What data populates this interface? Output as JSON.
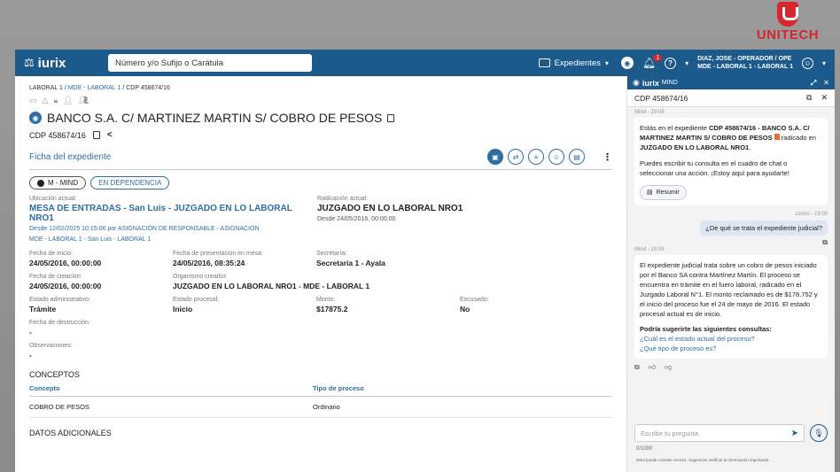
{
  "logo": {
    "text": "UNITECH"
  },
  "topbar": {
    "brand": "iurix",
    "search_placeholder": "Número y/o Sufijo o Carátula",
    "expedientes_label": "Expedientes",
    "notif_count": "1",
    "user_line1": "DIAZ, JOSE - OPERADOR / OPE",
    "user_line2": "MDE - LABORAL 1 - LABORAL 1"
  },
  "breadcrumb": {
    "p1": "LABORAL 1",
    "sep": " / ",
    "p2": "MDE - LABORAL 1",
    "p3": "CDP 458674/16"
  },
  "case": {
    "title": "BANCO S.A. C/ MARTINEZ MARTIN S/ COBRO DE PESOS",
    "number": "CDP 458674/16"
  },
  "ficha": {
    "title": "Ficha del expediente"
  },
  "chips": {
    "mind": "M - MIND",
    "status": "EN DEPENDENCIA"
  },
  "details": {
    "ubicacion_label": "Ubicación actual:",
    "ubicacion_value": "MESA DE ENTRADAS - San Luis - JUZGADO EN LO LABORAL NRO1",
    "ubicacion_sub1": "Desde 12/02/2025 10:15:06 por ASIGNACIÓN DE RESPONSABLE - ASIGNACIÓN",
    "ubicacion_sub2": "MDE - LABORAL 1 - San Luis - LABORAL 1",
    "radicacion_label": "Radicación actual:",
    "radicacion_value": "JUZGADO EN LO LABORAL NRO1",
    "radicacion_sub": "Desde 24/05/2016, 00:00:00",
    "inicio_label": "Fecha de inicio:",
    "inicio_value": "24/05/2016, 00:00:00",
    "presentacion_label": "Fecha de presentación en mesa:",
    "presentacion_value": "24/05/2016, 08:35:24",
    "secretaria_label": "Secretaría:",
    "secretaria_value": "Secretaria 1 - Ayala",
    "creacion_label": "Fecha de creación:",
    "creacion_value": "24/05/2016, 00:00:00",
    "organismo_label": "Organismo creador:",
    "organismo_value": "JUZGADO EN LO LABORAL NRO1 - MDE - LABORAL 1",
    "estado_adm_label": "Estado administrativo:",
    "estado_adm_value": "Trámite",
    "estado_proc_label": "Estado procesal:",
    "estado_proc_value": "Inicio",
    "monto_label": "Monto:",
    "monto_value": "$17875.2",
    "excusado_label": "Excusado:",
    "excusado_value": "No",
    "destruccion_label": "Fecha de destrucción:",
    "destruccion_value": "-",
    "observaciones_label": "Observaciones:",
    "observaciones_value": "-"
  },
  "conceptos": {
    "title": "CONCEPTOS",
    "headers": [
      "Concepto",
      "Tipo de proceso"
    ],
    "rows": [
      [
        "COBRO DE PESOS",
        "Ordinario"
      ]
    ]
  },
  "datos_adicionales": {
    "title": "DATOS ADICIONALES"
  },
  "mind": {
    "brand": "iurix",
    "brand_suffix": "MIND",
    "case_ref": "CDP 458674/16",
    "meta1": "Mind - 19:08",
    "msg1_a": "Estás en el expediente ",
    "msg1_b": "CDP 458674/16 - BANCO S.A. C/ MARTINEZ MARTIN S/ COBRO DE PESOS",
    "msg1_c": " radicado en ",
    "msg1_d": "JUZGADO EN LO LABORAL NRO1",
    "msg1_e": ".",
    "msg1_f": "Puedes escribir tu consulta en el cuadro de chat o seleccionar una acción. ¡Estoy aquí para ayudarte!",
    "resumir": "Resumir",
    "meta2": "czorio - 19:09",
    "user_msg": "¿De qué se trata el expediente judicial?",
    "meta3": "Mind - 19:09",
    "msg2": "El expediente judicial trata sobre un cobro de pesos iniciado por el Banco SA contra Martínez Martín. El proceso se encuentra en trámite en el fuero laboral, radicado en el Juzgado Laboral N°1. El monto reclamado es de $178.752 y el inicio del proceso fue el 24 de mayo de 2016. El estado procesal actual es de inicio.",
    "sugg_title": "Podría sugerirte las siguientes consultas:",
    "sugg1": "¿Cuál es el estado actual del proceso?",
    "sugg2": "¿Qué tipo de proceso es?",
    "input_placeholder": "Escribe tu pregunta",
    "counter": "0/1000",
    "disclaimer": "Mind puede cometer errores. Sugerimos verificar la información importante."
  }
}
